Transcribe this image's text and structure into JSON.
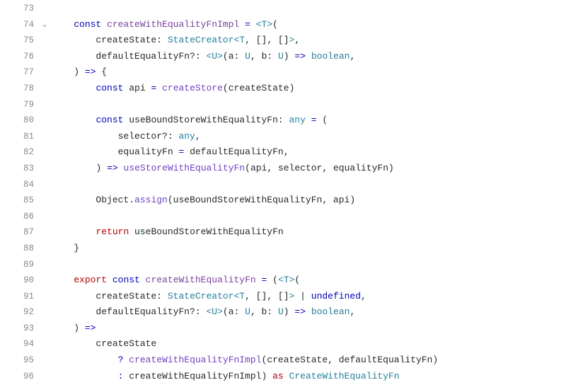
{
  "lines": [
    {
      "num": "73",
      "fold": "",
      "tokens": []
    },
    {
      "num": "74",
      "fold": "⌄",
      "tokens": [
        {
          "t": "kw-const",
          "v": "const"
        },
        {
          "t": "text",
          "v": " "
        },
        {
          "t": "fn-decl",
          "v": "createWithEqualityFnImpl"
        },
        {
          "t": "text",
          "v": " "
        },
        {
          "t": "op",
          "v": "="
        },
        {
          "t": "text",
          "v": " "
        },
        {
          "t": "angle",
          "v": "<"
        },
        {
          "t": "type",
          "v": "T"
        },
        {
          "t": "angle",
          "v": ">"
        },
        {
          "t": "punct",
          "v": "("
        }
      ]
    },
    {
      "num": "75",
      "fold": "",
      "tokens": [
        {
          "t": "text",
          "v": "    createState"
        },
        {
          "t": "punct",
          "v": ":"
        },
        {
          "t": "text",
          "v": " "
        },
        {
          "t": "type",
          "v": "StateCreator"
        },
        {
          "t": "angle",
          "v": "<"
        },
        {
          "t": "type",
          "v": "T"
        },
        {
          "t": "punct",
          "v": ", [], []"
        },
        {
          "t": "angle",
          "v": ">"
        },
        {
          "t": "punct",
          "v": ","
        }
      ]
    },
    {
      "num": "76",
      "fold": "",
      "tokens": [
        {
          "t": "text",
          "v": "    defaultEqualityFn"
        },
        {
          "t": "punct",
          "v": "?:"
        },
        {
          "t": "text",
          "v": " "
        },
        {
          "t": "angle",
          "v": "<"
        },
        {
          "t": "type",
          "v": "U"
        },
        {
          "t": "angle",
          "v": ">"
        },
        {
          "t": "punct",
          "v": "("
        },
        {
          "t": "param",
          "v": "a"
        },
        {
          "t": "punct",
          "v": ": "
        },
        {
          "t": "type",
          "v": "U"
        },
        {
          "t": "punct",
          "v": ", "
        },
        {
          "t": "param",
          "v": "b"
        },
        {
          "t": "punct",
          "v": ": "
        },
        {
          "t": "type",
          "v": "U"
        },
        {
          "t": "punct",
          "v": ")"
        },
        {
          "t": "text",
          "v": " "
        },
        {
          "t": "op",
          "v": "=>"
        },
        {
          "t": "text",
          "v": " "
        },
        {
          "t": "type",
          "v": "boolean"
        },
        {
          "t": "punct",
          "v": ","
        }
      ]
    },
    {
      "num": "77",
      "fold": "",
      "tokens": [
        {
          "t": "punct",
          "v": ")"
        },
        {
          "t": "text",
          "v": " "
        },
        {
          "t": "op",
          "v": "=>"
        },
        {
          "t": "text",
          "v": " "
        },
        {
          "t": "punct",
          "v": "{"
        }
      ]
    },
    {
      "num": "78",
      "fold": "",
      "tokens": [
        {
          "t": "text",
          "v": "    "
        },
        {
          "t": "kw-const",
          "v": "const"
        },
        {
          "t": "text",
          "v": " api "
        },
        {
          "t": "op",
          "v": "="
        },
        {
          "t": "text",
          "v": " "
        },
        {
          "t": "fn-call",
          "v": "createStore"
        },
        {
          "t": "punct",
          "v": "("
        },
        {
          "t": "text",
          "v": "createState"
        },
        {
          "t": "punct",
          "v": ")"
        }
      ]
    },
    {
      "num": "79",
      "fold": "",
      "tokens": []
    },
    {
      "num": "80",
      "fold": "",
      "tokens": [
        {
          "t": "text",
          "v": "    "
        },
        {
          "t": "kw-const",
          "v": "const"
        },
        {
          "t": "text",
          "v": " useBoundStoreWithEqualityFn"
        },
        {
          "t": "punct",
          "v": ": "
        },
        {
          "t": "type",
          "v": "any"
        },
        {
          "t": "text",
          "v": " "
        },
        {
          "t": "op",
          "v": "="
        },
        {
          "t": "text",
          "v": " "
        },
        {
          "t": "punct",
          "v": "("
        }
      ]
    },
    {
      "num": "81",
      "fold": "",
      "tokens": [
        {
          "t": "text",
          "v": "        selector"
        },
        {
          "t": "punct",
          "v": "?: "
        },
        {
          "t": "type",
          "v": "any"
        },
        {
          "t": "punct",
          "v": ","
        }
      ]
    },
    {
      "num": "82",
      "fold": "",
      "tokens": [
        {
          "t": "text",
          "v": "        equalityFn "
        },
        {
          "t": "op",
          "v": "="
        },
        {
          "t": "text",
          "v": " defaultEqualityFn"
        },
        {
          "t": "punct",
          "v": ","
        }
      ]
    },
    {
      "num": "83",
      "fold": "",
      "tokens": [
        {
          "t": "text",
          "v": "    "
        },
        {
          "t": "punct",
          "v": ")"
        },
        {
          "t": "text",
          "v": " "
        },
        {
          "t": "op",
          "v": "=>"
        },
        {
          "t": "text",
          "v": " "
        },
        {
          "t": "fn-call",
          "v": "useStoreWithEqualityFn"
        },
        {
          "t": "punct",
          "v": "("
        },
        {
          "t": "text",
          "v": "api"
        },
        {
          "t": "punct",
          "v": ", "
        },
        {
          "t": "text",
          "v": "selector"
        },
        {
          "t": "punct",
          "v": ", "
        },
        {
          "t": "text",
          "v": "equalityFn"
        },
        {
          "t": "punct",
          "v": ")"
        }
      ]
    },
    {
      "num": "84",
      "fold": "",
      "tokens": []
    },
    {
      "num": "85",
      "fold": "",
      "tokens": [
        {
          "t": "text",
          "v": "    Object"
        },
        {
          "t": "punct",
          "v": "."
        },
        {
          "t": "objcall",
          "v": "assign"
        },
        {
          "t": "punct",
          "v": "("
        },
        {
          "t": "text",
          "v": "useBoundStoreWithEqualityFn"
        },
        {
          "t": "punct",
          "v": ", "
        },
        {
          "t": "text",
          "v": "api"
        },
        {
          "t": "punct",
          "v": ")"
        }
      ]
    },
    {
      "num": "86",
      "fold": "",
      "tokens": []
    },
    {
      "num": "87",
      "fold": "",
      "tokens": [
        {
          "t": "text",
          "v": "    "
        },
        {
          "t": "kw-return",
          "v": "return"
        },
        {
          "t": "text",
          "v": " useBoundStoreWithEqualityFn"
        }
      ]
    },
    {
      "num": "88",
      "fold": "",
      "tokens": [
        {
          "t": "punct",
          "v": "}"
        }
      ]
    },
    {
      "num": "89",
      "fold": "",
      "tokens": []
    },
    {
      "num": "90",
      "fold": "",
      "tokens": [
        {
          "t": "kw-export",
          "v": "export"
        },
        {
          "t": "text",
          "v": " "
        },
        {
          "t": "kw-const",
          "v": "const"
        },
        {
          "t": "text",
          "v": " "
        },
        {
          "t": "fn-decl",
          "v": "createWithEqualityFn"
        },
        {
          "t": "text",
          "v": " "
        },
        {
          "t": "op",
          "v": "="
        },
        {
          "t": "text",
          "v": " "
        },
        {
          "t": "punct",
          "v": "("
        },
        {
          "t": "angle",
          "v": "<"
        },
        {
          "t": "type",
          "v": "T"
        },
        {
          "t": "angle",
          "v": ">"
        },
        {
          "t": "punct",
          "v": "("
        }
      ]
    },
    {
      "num": "91",
      "fold": "",
      "tokens": [
        {
          "t": "text",
          "v": "    createState"
        },
        {
          "t": "punct",
          "v": ": "
        },
        {
          "t": "type",
          "v": "StateCreator"
        },
        {
          "t": "angle",
          "v": "<"
        },
        {
          "t": "type",
          "v": "T"
        },
        {
          "t": "punct",
          "v": ", [], []"
        },
        {
          "t": "angle",
          "v": ">"
        },
        {
          "t": "text",
          "v": " "
        },
        {
          "t": "punct",
          "v": "|"
        },
        {
          "t": "text",
          "v": " "
        },
        {
          "t": "kw-undef",
          "v": "undefined"
        },
        {
          "t": "punct",
          "v": ","
        }
      ]
    },
    {
      "num": "92",
      "fold": "",
      "tokens": [
        {
          "t": "text",
          "v": "    defaultEqualityFn"
        },
        {
          "t": "punct",
          "v": "?: "
        },
        {
          "t": "angle",
          "v": "<"
        },
        {
          "t": "type",
          "v": "U"
        },
        {
          "t": "angle",
          "v": ">"
        },
        {
          "t": "punct",
          "v": "("
        },
        {
          "t": "param",
          "v": "a"
        },
        {
          "t": "punct",
          "v": ": "
        },
        {
          "t": "type",
          "v": "U"
        },
        {
          "t": "punct",
          "v": ", "
        },
        {
          "t": "param",
          "v": "b"
        },
        {
          "t": "punct",
          "v": ": "
        },
        {
          "t": "type",
          "v": "U"
        },
        {
          "t": "punct",
          "v": ")"
        },
        {
          "t": "text",
          "v": " "
        },
        {
          "t": "op",
          "v": "=>"
        },
        {
          "t": "text",
          "v": " "
        },
        {
          "t": "type",
          "v": "boolean"
        },
        {
          "t": "punct",
          "v": ","
        }
      ]
    },
    {
      "num": "93",
      "fold": "",
      "tokens": [
        {
          "t": "punct",
          "v": ")"
        },
        {
          "t": "text",
          "v": " "
        },
        {
          "t": "op",
          "v": "=>"
        }
      ]
    },
    {
      "num": "94",
      "fold": "",
      "tokens": [
        {
          "t": "text",
          "v": "    createState"
        }
      ]
    },
    {
      "num": "95",
      "fold": "",
      "tokens": [
        {
          "t": "text",
          "v": "        "
        },
        {
          "t": "op",
          "v": "?"
        },
        {
          "t": "text",
          "v": " "
        },
        {
          "t": "fn-call",
          "v": "createWithEqualityFnImpl"
        },
        {
          "t": "punct",
          "v": "("
        },
        {
          "t": "text",
          "v": "createState"
        },
        {
          "t": "punct",
          "v": ", "
        },
        {
          "t": "text",
          "v": "defaultEqualityFn"
        },
        {
          "t": "punct",
          "v": ")"
        }
      ]
    },
    {
      "num": "96",
      "fold": "",
      "tokens": [
        {
          "t": "text",
          "v": "        "
        },
        {
          "t": "op",
          "v": ":"
        },
        {
          "t": "text",
          "v": " createWithEqualityFnImpl"
        },
        {
          "t": "punct",
          "v": ")"
        },
        {
          "t": "text",
          "v": " "
        },
        {
          "t": "kw-as",
          "v": "as"
        },
        {
          "t": "text",
          "v": " "
        },
        {
          "t": "type",
          "v": "CreateWithEqualityFn"
        }
      ]
    }
  ],
  "indent_base": "    "
}
